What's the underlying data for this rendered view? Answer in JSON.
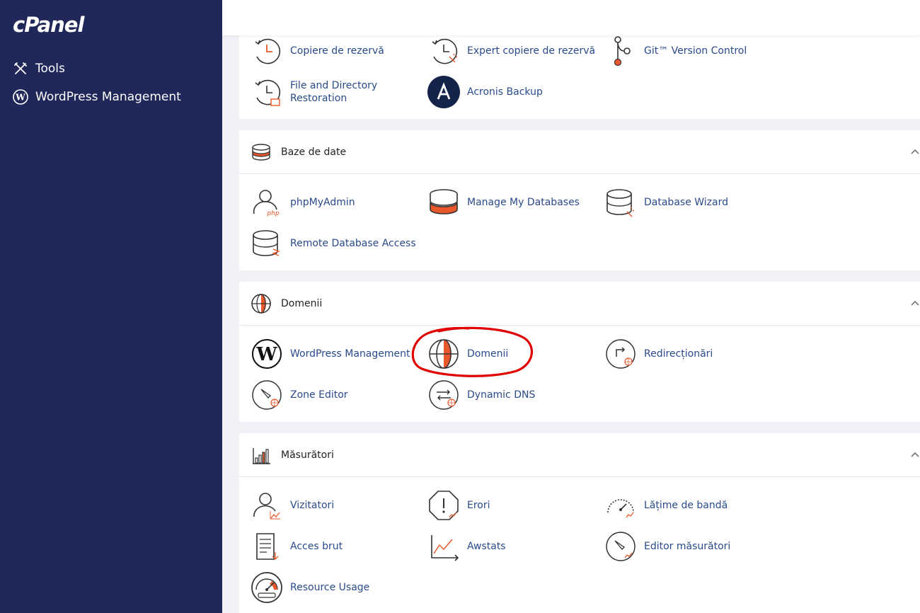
{
  "sidebar": {
    "logo": "cPanel",
    "items": [
      {
        "label": "Tools",
        "icon": "tools-icon"
      },
      {
        "label": "WordPress Management",
        "icon": "wordpress-icon"
      }
    ]
  },
  "colors": {
    "sidebar_bg": "#20285a",
    "accent_orange": "#e8582c",
    "link_blue": "#2a4a8a",
    "annotation_red": "#e00000"
  },
  "files": {
    "items": [
      {
        "label": "Copiere de rezervă",
        "icon": "backup-icon"
      },
      {
        "label": "Expert copiere de rezervă",
        "icon": "backup-wizard-icon"
      },
      {
        "label": "Git™ Version Control",
        "icon": "git-icon"
      },
      {
        "label": "File and Directory Restoration",
        "icon": "file-restore-icon"
      },
      {
        "label": "Acronis Backup",
        "icon": "acronis-icon"
      }
    ]
  },
  "databases": {
    "title": "Baze de date",
    "items": [
      {
        "label": "phpMyAdmin",
        "icon": "phpmyadmin-icon",
        "icon_text": "php"
      },
      {
        "label": "Manage My Databases",
        "icon": "database-icon"
      },
      {
        "label": "Database Wizard",
        "icon": "database-wizard-icon"
      },
      {
        "label": "Remote Database Access",
        "icon": "remote-database-icon"
      }
    ]
  },
  "domains": {
    "title": "Domenii",
    "items": [
      {
        "label": "WordPress Management",
        "icon": "wordpress-icon"
      },
      {
        "label": "Domenii",
        "icon": "globe-icon"
      },
      {
        "label": "Redirecționări",
        "icon": "redirect-icon"
      },
      {
        "label": "Zone Editor",
        "icon": "zone-editor-icon"
      },
      {
        "label": "Dynamic DNS",
        "icon": "dynamic-dns-icon"
      }
    ]
  },
  "metrics": {
    "title": "Măsurători",
    "items": [
      {
        "label": "Vizitatori",
        "icon": "visitors-icon"
      },
      {
        "label": "Erori",
        "icon": "errors-icon"
      },
      {
        "label": "Lățime de bandă",
        "icon": "bandwidth-icon"
      },
      {
        "label": "Acces brut",
        "icon": "raw-access-icon"
      },
      {
        "label": "Awstats",
        "icon": "awstats-icon"
      },
      {
        "label": "Editor măsurători",
        "icon": "metrics-editor-icon"
      },
      {
        "label": "Resource Usage",
        "icon": "resource-usage-icon"
      }
    ]
  }
}
